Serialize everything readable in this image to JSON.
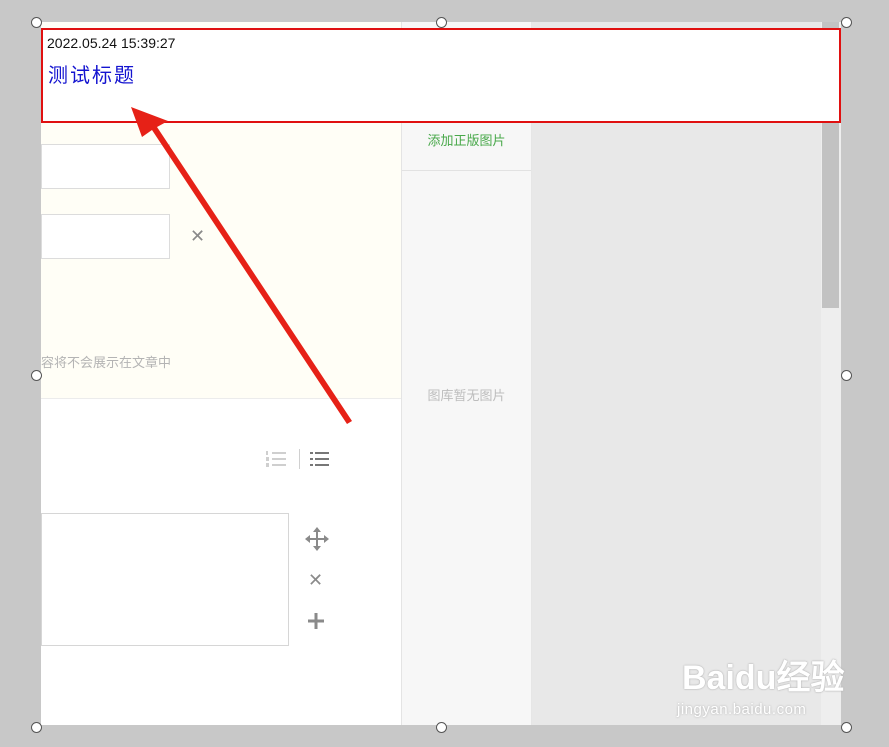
{
  "title_box": {
    "timestamp": "2022.05.24 15:39:27",
    "title": "测试标题"
  },
  "editor": {
    "hint_text": "容将不会展示在文章中"
  },
  "gallery": {
    "add_label": "添加正版图片",
    "empty_label": "图库暂无图片"
  },
  "watermark": {
    "brand": "Baidu经验",
    "url": "jingyan.baidu.com"
  },
  "icons": {
    "remove": "close-icon",
    "ordered_list": "ordered-list-icon",
    "unordered_list": "unordered-list-icon",
    "move": "move-icon",
    "add": "plus-icon"
  },
  "colors": {
    "title_border": "#e01010",
    "title_text": "#1414d0",
    "arrow": "#e62117",
    "gallery_link": "#48a84a"
  }
}
